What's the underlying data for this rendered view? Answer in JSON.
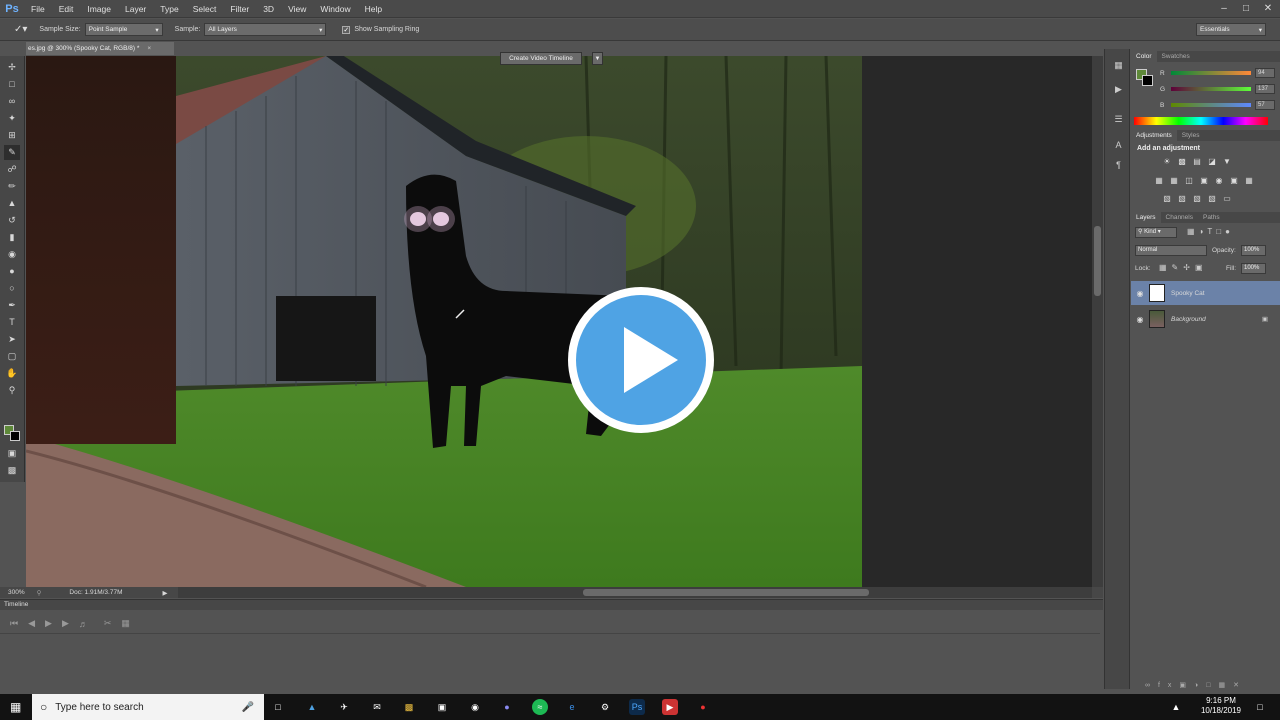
{
  "app": {
    "logo": "Ps",
    "menus": [
      "File",
      "Edit",
      "Image",
      "Layer",
      "Type",
      "Select",
      "Filter",
      "3D",
      "View",
      "Window",
      "Help"
    ]
  },
  "options": {
    "sample_size_label": "Sample Size:",
    "sample_size_value": "Point Sample",
    "sample_label": "Sample:",
    "sample_value": "All Layers",
    "show_ring_label": "Show Sampling Ring",
    "workspace": "Essentials"
  },
  "document": {
    "tab_title": "es.jpg @ 300% (Spooky Cat, RGB/8) *",
    "zoom": "300%",
    "doc_size": "Doc: 1.91M/3.77M"
  },
  "color_panel": {
    "tabs": [
      "Color",
      "Swatches"
    ],
    "fg_color": "#5e8939",
    "r": "94",
    "g": "137",
    "b": "57"
  },
  "adjustments_panel": {
    "tabs": [
      "Adjustments",
      "Styles"
    ],
    "heading": "Add an adjustment"
  },
  "layers_panel": {
    "tabs": [
      "Layers",
      "Channels",
      "Paths"
    ],
    "filter_kind": "Kind",
    "blend_mode": "Normal",
    "opacity_label": "Opacity:",
    "opacity_value": "100%",
    "lock_label": "Lock:",
    "fill_label": "Fill:",
    "fill_value": "100%",
    "layers": [
      {
        "name": "Spooky Cat",
        "selected": true
      },
      {
        "name": "Background",
        "selected": false
      }
    ]
  },
  "timeline": {
    "title": "Timeline",
    "create_button": "Create Video Timeline"
  },
  "taskbar": {
    "search_placeholder": "Type here to search",
    "time": "9:16 PM",
    "date": "10/18/2019"
  }
}
